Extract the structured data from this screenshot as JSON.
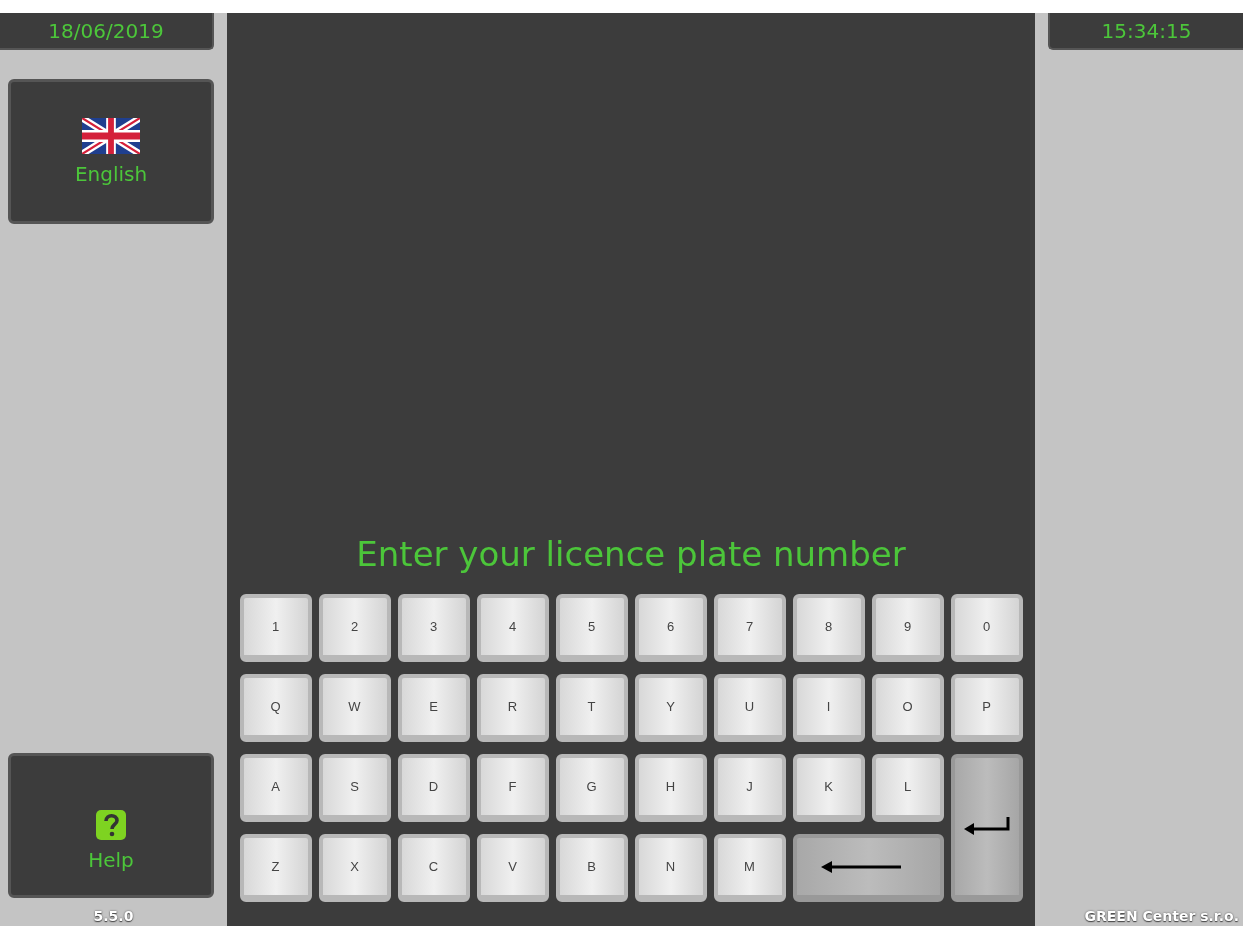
{
  "date": "18/06/2019",
  "time": "15:34:15",
  "language_button": {
    "label": "English"
  },
  "help_button": {
    "label": "Help"
  },
  "version": "5.5.0",
  "company": "GREEN Center s.r.o.",
  "prompt": "Enter your licence plate number",
  "keys": [
    {
      "kind": "char",
      "label": "1"
    },
    {
      "kind": "char",
      "label": "2"
    },
    {
      "kind": "char",
      "label": "3"
    },
    {
      "kind": "char",
      "label": "4"
    },
    {
      "kind": "char",
      "label": "5"
    },
    {
      "kind": "char",
      "label": "6"
    },
    {
      "kind": "char",
      "label": "7"
    },
    {
      "kind": "char",
      "label": "8"
    },
    {
      "kind": "char",
      "label": "9"
    },
    {
      "kind": "char",
      "label": "0"
    },
    {
      "kind": "char",
      "label": "Q"
    },
    {
      "kind": "char",
      "label": "W"
    },
    {
      "kind": "char",
      "label": "E"
    },
    {
      "kind": "char",
      "label": "R"
    },
    {
      "kind": "char",
      "label": "T"
    },
    {
      "kind": "char",
      "label": "Y"
    },
    {
      "kind": "char",
      "label": "U"
    },
    {
      "kind": "char",
      "label": "I"
    },
    {
      "kind": "char",
      "label": "O"
    },
    {
      "kind": "char",
      "label": "P"
    },
    {
      "kind": "char",
      "label": "A"
    },
    {
      "kind": "char",
      "label": "S"
    },
    {
      "kind": "char",
      "label": "D"
    },
    {
      "kind": "char",
      "label": "F"
    },
    {
      "kind": "char",
      "label": "G"
    },
    {
      "kind": "char",
      "label": "H"
    },
    {
      "kind": "char",
      "label": "J"
    },
    {
      "kind": "char",
      "label": "K"
    },
    {
      "kind": "char",
      "label": "L"
    },
    {
      "kind": "enter"
    },
    {
      "kind": "char",
      "label": "Z"
    },
    {
      "kind": "char",
      "label": "X"
    },
    {
      "kind": "char",
      "label": "C"
    },
    {
      "kind": "char",
      "label": "V"
    },
    {
      "kind": "char",
      "label": "B"
    },
    {
      "kind": "char",
      "label": "N"
    },
    {
      "kind": "char",
      "label": "M"
    },
    {
      "kind": "backspace"
    }
  ]
}
